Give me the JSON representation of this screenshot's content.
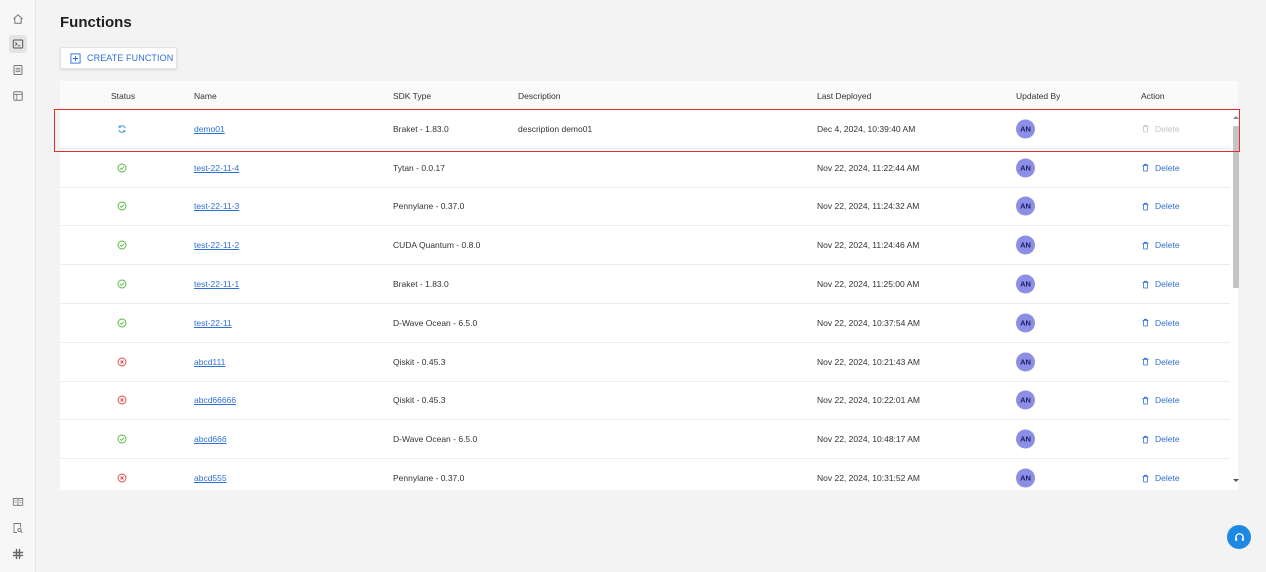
{
  "page": {
    "title": "Functions"
  },
  "toolbar": {
    "create_label": "CREATE FUNCTION"
  },
  "table": {
    "columns": [
      "Status",
      "Name",
      "SDK Type",
      "Description",
      "Last Deployed",
      "Updated By",
      "Action"
    ],
    "rows": [
      {
        "status": "deploying",
        "name": "demo01",
        "sdk": "Braket - 1.83.0",
        "description": "description demo01",
        "last_deployed": "Dec 4, 2024, 10:39:40 AM",
        "updated_by": "AN",
        "action": "Delete",
        "action_disabled": true
      },
      {
        "status": "success",
        "name": "test-22-11-4",
        "sdk": "Tytan - 0.0.17",
        "description": "",
        "last_deployed": "Nov 22, 2024, 11:22:44 AM",
        "updated_by": "AN",
        "action": "Delete",
        "action_disabled": false
      },
      {
        "status": "success",
        "name": "test-22-11-3",
        "sdk": "Pennylane - 0.37.0",
        "description": "",
        "last_deployed": "Nov 22, 2024, 11:24:32 AM",
        "updated_by": "AN",
        "action": "Delete",
        "action_disabled": false
      },
      {
        "status": "success",
        "name": "test-22-11-2",
        "sdk": "CUDA Quantum - 0.8.0",
        "description": "",
        "last_deployed": "Nov 22, 2024, 11:24:46 AM",
        "updated_by": "AN",
        "action": "Delete",
        "action_disabled": false
      },
      {
        "status": "success",
        "name": "test-22-11-1",
        "sdk": "Braket - 1.83.0",
        "description": "",
        "last_deployed": "Nov 22, 2024, 11:25:00 AM",
        "updated_by": "AN",
        "action": "Delete",
        "action_disabled": false
      },
      {
        "status": "success",
        "name": "test-22-11",
        "sdk": "D-Wave Ocean - 6.5.0",
        "description": "",
        "last_deployed": "Nov 22, 2024, 10:37:54 AM",
        "updated_by": "AN",
        "action": "Delete",
        "action_disabled": false
      },
      {
        "status": "failed",
        "name": "abcd111",
        "sdk": "Qiskit - 0.45.3",
        "description": "",
        "last_deployed": "Nov 22, 2024, 10:21:43 AM",
        "updated_by": "AN",
        "action": "Delete",
        "action_disabled": false
      },
      {
        "status": "failed",
        "name": "abcd66666",
        "sdk": "Qiskit - 0.45.3",
        "description": "",
        "last_deployed": "Nov 22, 2024, 10:22:01 AM",
        "updated_by": "AN",
        "action": "Delete",
        "action_disabled": false
      },
      {
        "status": "success",
        "name": "abcd666",
        "sdk": "D-Wave Ocean - 6.5.0",
        "description": "",
        "last_deployed": "Nov 22, 2024, 10:48:17 AM",
        "updated_by": "AN",
        "action": "Delete",
        "action_disabled": false
      },
      {
        "status": "failed",
        "name": "abcd555",
        "sdk": "Pennylane - 0.37.0",
        "description": "",
        "last_deployed": "Nov 22, 2024, 10:31:52 AM",
        "updated_by": "AN",
        "action": "Delete",
        "action_disabled": false
      }
    ]
  },
  "sidebar": {
    "items": [
      {
        "icon": "home-icon",
        "active": false
      },
      {
        "icon": "terminal-icon",
        "active": true
      },
      {
        "icon": "list-icon",
        "active": false
      },
      {
        "icon": "panel-icon",
        "active": false
      }
    ],
    "bottom_items": [
      {
        "icon": "book-icon"
      },
      {
        "icon": "search-doc-icon"
      },
      {
        "icon": "slack-icon"
      }
    ]
  },
  "colors": {
    "accent": "#2f6fd6",
    "success": "#52b83a",
    "failed": "#e04646",
    "deploying": "#2f8fe0",
    "avatar": "#8d8fe6",
    "highlight": "#e0302a",
    "help": "#1e88e5"
  }
}
